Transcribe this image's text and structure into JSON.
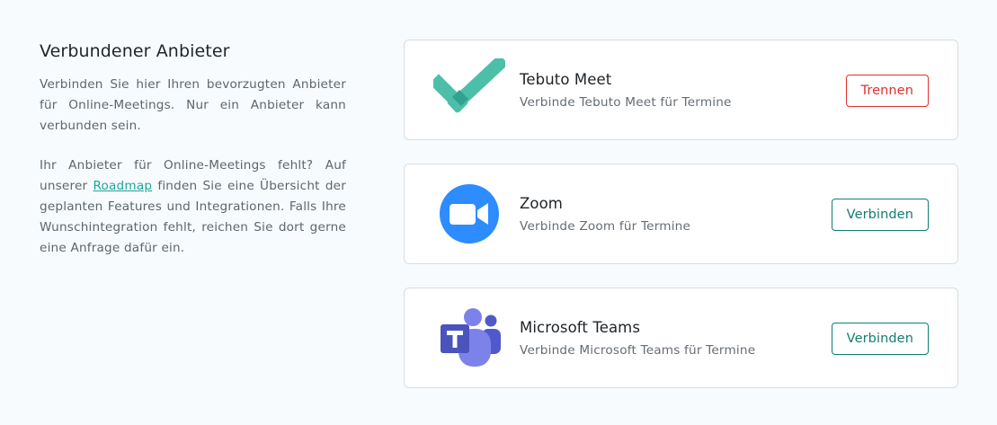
{
  "section": {
    "title": "Verbundener Anbieter",
    "paragraph_1": "Verbinden Sie hier Ihren bevorzugten Anbie­ter für Online-Meetings. Nur ein Anbieter kann verbunden sein.",
    "paragraph_2_before": "Ihr Anbieter für Online-Meetings fehlt? Auf unserer ",
    "roadmap_link": "Roadmap",
    "paragraph_2_after": " finden Sie eine Übersicht der geplanten Features und Integrationen. Falls Ihre Wunschintegration fehlt, reichen Sie dort gerne eine Anfrage dafür ein."
  },
  "providers": [
    {
      "name": "Tebuto Meet",
      "description": "Verbinde Tebuto Meet für Termine",
      "action": "Trennen",
      "icon": "tebuto-checkmark-icon",
      "connected": true
    },
    {
      "name": "Zoom",
      "description": "Verbinde Zoom für Termine",
      "action": "Verbinden",
      "icon": "zoom-icon",
      "connected": false
    },
    {
      "name": "Microsoft Teams",
      "description": "Verbinde Microsoft Teams für Termine",
      "action": "Verbinden",
      "icon": "microsoft-teams-icon",
      "connected": false
    }
  ],
  "colors": {
    "background": "#f7fbfd",
    "link": "#1da59a",
    "danger": "#e0312f",
    "primary": "#117d72",
    "tebuto_green": "#4dbfa9",
    "zoom_blue": "#2d8cff",
    "teams_purple": "#5059c9"
  }
}
